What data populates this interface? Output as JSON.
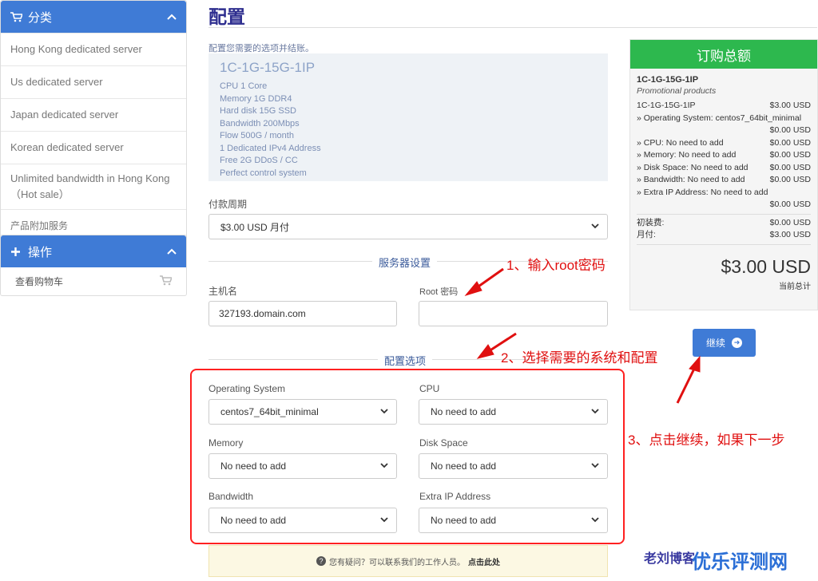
{
  "sidebar": {
    "categories": {
      "title": "分类",
      "items": [
        "Hong Kong dedicated server",
        "Us dedicated server",
        "Japan dedicated server",
        "Korean dedicated server",
        "Unlimited bandwidth in Hong Kong （Hot sale）",
        "产品附加服务"
      ]
    },
    "actions": {
      "title": "操作",
      "cart_label": "查看购物车"
    }
  },
  "main": {
    "title": "配置",
    "subtitle": "配置您需要的选项并结账。",
    "product": {
      "name": "1C-1G-15G-1IP",
      "features": [
        "CPU 1 Core",
        "Memory 1G DDR4",
        "Hard disk 15G SSD",
        "Bandwidth 200Mbps",
        "Flow 500G / month",
        "1 Dedicated IPv4 Address",
        "Free 2G DDoS / CC",
        "Perfect control system"
      ]
    },
    "billing": {
      "label": "付款周期",
      "value": "$3.00 USD 月付"
    },
    "server_section": {
      "title": "服务器设置",
      "hostname_label": "主机名",
      "hostname_value": "327193.domain.com",
      "root_label": "Root 密码",
      "root_value": ""
    },
    "config_section": {
      "title": "配置选项",
      "os_label": "Operating System",
      "os_value": "centos7_64bit_minimal",
      "cpu_label": "CPU",
      "cpu_value": "No need to add",
      "memory_label": "Memory",
      "memory_value": "No need to add",
      "disk_label": "Disk Space",
      "disk_value": "No need to add",
      "bandwidth_label": "Bandwidth",
      "bandwidth_value": "No need to add",
      "extra_ip_label": "Extra IP Address",
      "extra_ip_value": "No need to add"
    },
    "help": {
      "text": "您有疑问？可以联系我们的工作人员。",
      "link": "点击此处"
    }
  },
  "summary": {
    "title": "订购总额",
    "product_name": "1C-1G-15G-1IP",
    "promo": "Promotional products",
    "line_name": "1C-1G-15G-1IP",
    "line_price": "$3.00 USD",
    "os_line": "» Operating System: centos7_64bit_minimal",
    "os_price": "$0.00 USD",
    "cpu_line": "» CPU: No need to add",
    "cpu_price": "$0.00 USD",
    "mem_line": "» Memory: No need to add",
    "mem_price": "$0.00 USD",
    "disk_line": "» Disk Space: No need to add",
    "disk_price": "$0.00 USD",
    "bw_line": "» Bandwidth: No need to add",
    "bw_price": "$0.00 USD",
    "ip_line": "» Extra IP Address: No need to add",
    "ip_price": "$0.00 USD",
    "setup_label": "初装费:",
    "setup_price": "$0.00 USD",
    "monthly_label": "月付:",
    "monthly_price": "$3.00 USD",
    "total": "$3.00 USD",
    "total_label": "当前总计",
    "continue_label": "继续"
  },
  "annotations": {
    "step1": "1、输入root密码",
    "step2": "2、选择需要的系统和配置",
    "step3": "3、点击继续，如果下一步"
  },
  "watermark": {
    "left": "老刘博客",
    "right": "优乐评测网"
  },
  "colors": {
    "primary": "#3f7bd6",
    "success": "#2db84e",
    "annotation": "#e01010",
    "watermark_left": "#3a3aa0",
    "watermark_right": "#2b6fd6"
  },
  "icons": {
    "categories": "cart-icon",
    "actions": "plus-icon",
    "cart_link": "cart-icon",
    "collapse": "chevron-up-icon",
    "select": "chevron-down-icon",
    "help": "question-circle-icon",
    "continue": "arrow-circle-right-icon"
  }
}
